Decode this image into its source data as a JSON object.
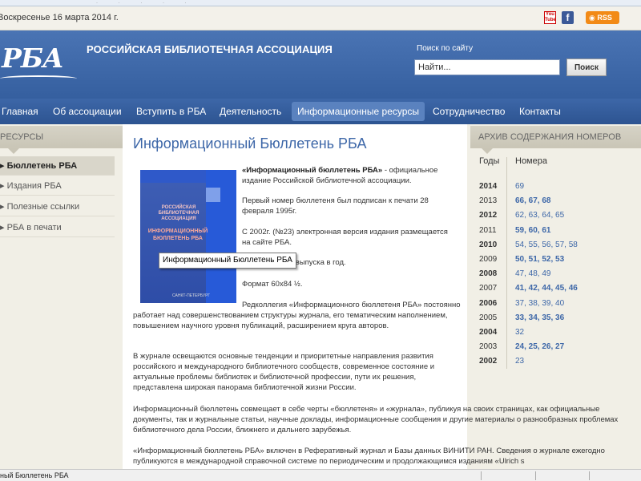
{
  "topbar": {
    "date": "Воскресенье 16 марта 2014 г.",
    "youtube_icon_text": "You Tube",
    "facebook_icon_text": "f",
    "rss_label": "RSS"
  },
  "header": {
    "logo_text": "РБА",
    "org_name": "РОССИЙСКАЯ БИБЛИОТЕЧНАЯ АССОЦИАЦИЯ",
    "search_label": "Поиск по сайту",
    "search_value": "Найти...",
    "search_button": "Поиск"
  },
  "nav": {
    "items": [
      {
        "label": "Главная"
      },
      {
        "label": "Об ассоциации"
      },
      {
        "label": "Вступить в РБА"
      },
      {
        "label": "Деятельность"
      },
      {
        "label": "Информационные ресурсы"
      },
      {
        "label": "Сотрудничество"
      },
      {
        "label": "Контакты"
      }
    ]
  },
  "sidebar": {
    "heading": "РЕСУРСЫ",
    "items": [
      {
        "label": "Бюллетень РБА"
      },
      {
        "label": "Издания РБА"
      },
      {
        "label": "Полезные ссылки"
      },
      {
        "label": "РБА в печати"
      }
    ]
  },
  "content": {
    "title": "Информационный Бюллетень РБА",
    "cover": {
      "org_text": "РОССИЙСКАЯ БИБЛИОТЕЧНАЯ АССОЦИАЦИЯ",
      "title_text": "ИНФОРМАЦИОННЫЙ БЮЛЛЕТЕНЬ РБА",
      "footer_text": "САНКТ-ПЕТЕРБУРГ"
    },
    "tooltip": "Информационный Бюллетень РБА",
    "intro_bold": "«Информационный бюллетень РБА»",
    "intro_rest": " - официальное издание Российской библиотечной ассоциации.",
    "p_first": "Первый номер бюллетеня был подписан к печати 28 февраля 1995г.",
    "p_2002": "С 2002г. (№23) электронная версия издания размещается на сайте РБА.",
    "p_period": "ть – 4 выпуска в год.",
    "p_format": "Формат 60х84 ½.",
    "p_editorial": "Редколлегия «Информационного бюллетеня РБА» постоянно работает над совершенствованием структуры журнала, его тематическим наполнением, повышением научного уровня публикаций, расширением круга авторов.",
    "p_trends": "В журнале освещаются основные тенденции и приоритетные направления развития российского и международного библиотечного сообществ, современное состояние и актуальные проблемы библиотек и библиотечной профессии, пути их решения, представлена широкая панорама библиотечной жизни России.",
    "p_combines": "Информационный бюллетень совмещает в себе черты «бюллетеня» и «журнала», публикуя на своих страницах, как официальные документы, так и журнальные статьи, научные доклады, информационные сообщения и другие материалы о разнообразных проблемах библиотечного дела России, ближнего и дальнего зарубежья.",
    "p_included": "«Информационный бюллетень РБА» включен в Реферативный журнал и Базы данных ВИНИТИ РАН. Сведения о журнале ежегодно публикуются в международной справочной системе по периодическим и продолжающимся изданиям «Ulrich s"
  },
  "archive": {
    "heading": "АРХИВ СОДЕРЖАНИЯ НОМЕРОВ",
    "col_years": "Годы",
    "col_issues": "Номера",
    "rows": [
      {
        "year": "2014",
        "issues": "69",
        "year_bold": true,
        "issues_bold": false
      },
      {
        "year": "2013",
        "issues": "66, 67, 68",
        "year_bold": false,
        "issues_bold": true
      },
      {
        "year": "2012",
        "issues": "62, 63, 64, 65",
        "year_bold": true,
        "issues_bold": false
      },
      {
        "year": "2011",
        "issues": "59, 60, 61",
        "year_bold": false,
        "issues_bold": true
      },
      {
        "year": "2010",
        "issues": "54, 55, 56, 57, 58",
        "year_bold": true,
        "issues_bold": false
      },
      {
        "year": "2009",
        "issues": "50, 51, 52, 53",
        "year_bold": false,
        "issues_bold": true
      },
      {
        "year": "2008",
        "issues": "47, 48, 49",
        "year_bold": true,
        "issues_bold": false
      },
      {
        "year": "2007",
        "issues": "41, 42, 44, 45, 46",
        "year_bold": false,
        "issues_bold": true
      },
      {
        "year": "2006",
        "issues": "37, 38, 39, 40",
        "year_bold": true,
        "issues_bold": false
      },
      {
        "year": "2005",
        "issues": "33, 34, 35, 36",
        "year_bold": false,
        "issues_bold": true
      },
      {
        "year": "2004",
        "issues": "32",
        "year_bold": true,
        "issues_bold": false
      },
      {
        "year": "2003",
        "issues": "24, 25, 26, 27",
        "year_bold": false,
        "issues_bold": true
      },
      {
        "year": "2002",
        "issues": "23",
        "year_bold": true,
        "issues_bold": false
      }
    ]
  },
  "statusbar": {
    "text": "ный Бюллетень РБА"
  },
  "colors": {
    "header_blue": "#4a74b4",
    "nav_blue": "#2d5491",
    "link_blue": "#3d67a8",
    "rss_orange": "#f28a16",
    "panel_beige": "#f1efe6"
  }
}
